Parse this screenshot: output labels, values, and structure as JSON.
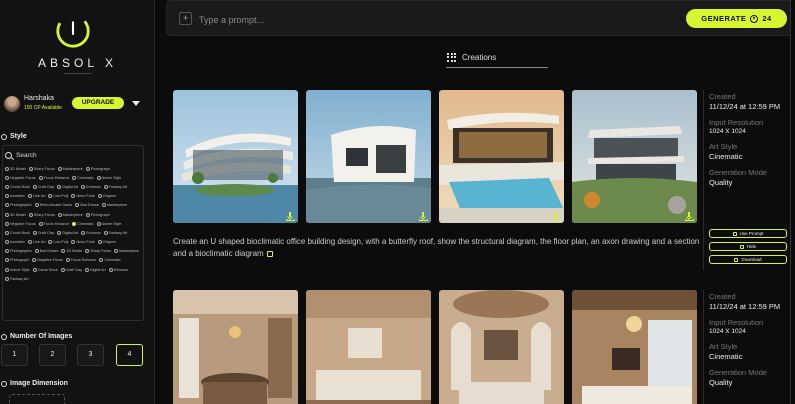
{
  "brand": {
    "name": "ABSOL X"
  },
  "user": {
    "name": "Harshaka",
    "credits": "150 CP Available",
    "upgrade_label": "UPGRADE"
  },
  "style_section": {
    "title": "Style",
    "search_label": "Search",
    "options": [
      "3D Model",
      "Sharp Focus",
      "Masterpiece",
      "Photograph",
      "Negative Focus",
      "Focus Enhance",
      "Cinematic",
      "Anime Style",
      "Comic Book",
      "Craft Clay",
      "Digital Art",
      "Enhance",
      "Fantasy Art",
      "Isometric",
      "Line Art",
      "Low Poly",
      "Neon Punk",
      "Origami",
      "Photographic",
      "Retro Arcade Game",
      "Bad Dream",
      "Masterpiece",
      "3D Model",
      "Sharp Focus",
      "Masterpiece",
      "Photograph",
      "Negative Focus",
      "Focus Enhance",
      "Cinematic",
      "Anime Style",
      "Comic Book",
      "Craft Clay",
      "Digital Art",
      "Enhance",
      "Fantasy Art",
      "Isometric",
      "Line Art",
      "Low Poly",
      "Neon Punk",
      "Origami",
      "Photographic",
      "Bad Dream",
      "3D Model",
      "Sharp Focus",
      "Masterpiece",
      "Photograph",
      "Negative Focus",
      "Focus Enhance",
      "Cinematic",
      "Anime Style",
      "Comic Book",
      "Craft Clay",
      "Digital Art",
      "Enhance",
      "Fantasy Art"
    ],
    "selected_index": 28
  },
  "number_of_images": {
    "title": "Number Of Images",
    "options": [
      "1",
      "2",
      "3",
      "4"
    ],
    "selected": "4"
  },
  "image_dimension": {
    "title": "Image Dimension"
  },
  "prompt": {
    "placeholder": "Type a prompt...",
    "generate_label": "GENERATE",
    "cost": "24"
  },
  "tabs": {
    "creations": "Creations"
  },
  "creations": [
    {
      "description": "Create an U shaped bioclimatic office building design, with a butterfly roof, show the structural diagram, the floor plan, an axon drawing and a section and a bioclimatic diagram",
      "created_label": "Created",
      "created": "11/12/24 at 12:59 PM",
      "resolution_label": "Input Resolution",
      "resolution": "1024 X 1024",
      "style_label": "Art Style",
      "style": "Cinematic",
      "mode_label": "Generation Mode",
      "mode": "Quality",
      "use_prompt_label": "Use Prompt",
      "hide_label": "Hide",
      "download_label": "Download"
    },
    {
      "created_label": "Created",
      "created": "11/12/24 at 12:59 PM",
      "resolution_label": "Input Resolution",
      "resolution": "1024 X 1024",
      "style_label": "Art Style",
      "style": "Cinematic",
      "mode_label": "Generation Mode",
      "mode": "Quality"
    }
  ],
  "colors": {
    "accent": "#d7f531",
    "bg": "#0c0c0c",
    "panel": "#121212"
  }
}
